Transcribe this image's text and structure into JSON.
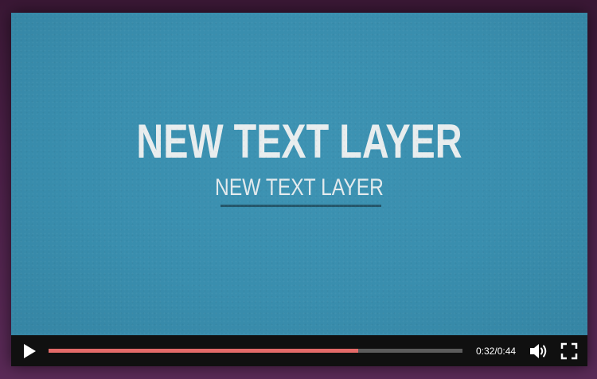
{
  "video": {
    "title": "NEW TEXT LAYER",
    "subtitle": "NEW TEXT LAYER",
    "background_color": "#398eae"
  },
  "controls": {
    "current_time": "0:32",
    "duration": "0:44",
    "time_display": "0:32/0:44",
    "progress_fraction": 0.748,
    "progress_color": "#e46b69",
    "play_icon": "play-icon",
    "volume_icon": "volume-icon",
    "fullscreen_icon": "fullscreen-icon"
  }
}
